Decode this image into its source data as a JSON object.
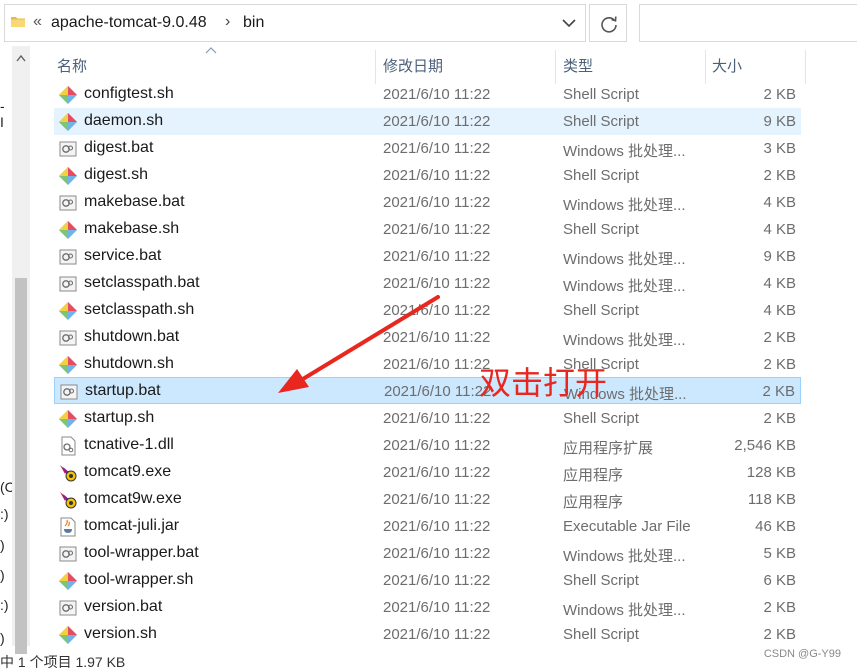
{
  "address": {
    "segments": [
      "apache-tomcat-9.0.48",
      "bin"
    ],
    "chevron": "«",
    "separator": "›"
  },
  "left_nav_fragments": [
    "- I",
    "(C",
    ":)",
    ")",
    ")",
    ":)",
    ")"
  ],
  "columns": {
    "name": "名称",
    "date": "修改日期",
    "type": "类型",
    "size": "大小"
  },
  "files": [
    {
      "name": "configtest.sh",
      "date": "2021/6/10 11:22",
      "type": "Shell Script",
      "size": "2 KB",
      "icon": "shell-script-icon"
    },
    {
      "name": "daemon.sh",
      "date": "2021/6/10 11:22",
      "type": "Shell Script",
      "size": "9 KB",
      "icon": "shell-script-icon",
      "state": "hover"
    },
    {
      "name": "digest.bat",
      "date": "2021/6/10 11:22",
      "type": "Windows 批处理...",
      "size": "3 KB",
      "icon": "batch-file-icon"
    },
    {
      "name": "digest.sh",
      "date": "2021/6/10 11:22",
      "type": "Shell Script",
      "size": "2 KB",
      "icon": "shell-script-icon"
    },
    {
      "name": "makebase.bat",
      "date": "2021/6/10 11:22",
      "type": "Windows 批处理...",
      "size": "4 KB",
      "icon": "batch-file-icon"
    },
    {
      "name": "makebase.sh",
      "date": "2021/6/10 11:22",
      "type": "Shell Script",
      "size": "4 KB",
      "icon": "shell-script-icon"
    },
    {
      "name": "service.bat",
      "date": "2021/6/10 11:22",
      "type": "Windows 批处理...",
      "size": "9 KB",
      "icon": "batch-file-icon"
    },
    {
      "name": "setclasspath.bat",
      "date": "2021/6/10 11:22",
      "type": "Windows 批处理...",
      "size": "4 KB",
      "icon": "batch-file-icon"
    },
    {
      "name": "setclasspath.sh",
      "date": "2021/6/10 11:22",
      "type": "Shell Script",
      "size": "4 KB",
      "icon": "shell-script-icon"
    },
    {
      "name": "shutdown.bat",
      "date": "2021/6/10 11:22",
      "type": "Windows 批处理...",
      "size": "2 KB",
      "icon": "batch-file-icon"
    },
    {
      "name": "shutdown.sh",
      "date": "2021/6/10 11:22",
      "type": "Shell Script",
      "size": "2 KB",
      "icon": "shell-script-icon"
    },
    {
      "name": "startup.bat",
      "date": "2021/6/10 11:22",
      "type": "Windows 批处理...",
      "size": "2 KB",
      "icon": "batch-file-icon",
      "state": "selected"
    },
    {
      "name": "startup.sh",
      "date": "2021/6/10 11:22",
      "type": "Shell Script",
      "size": "2 KB",
      "icon": "shell-script-icon"
    },
    {
      "name": "tcnative-1.dll",
      "date": "2021/6/10 11:22",
      "type": "应用程序扩展",
      "size": "2,546 KB",
      "icon": "dll-file-icon"
    },
    {
      "name": "tomcat9.exe",
      "date": "2021/6/10 11:22",
      "type": "应用程序",
      "size": "128 KB",
      "icon": "tomcat-exe-icon"
    },
    {
      "name": "tomcat9w.exe",
      "date": "2021/6/10 11:22",
      "type": "应用程序",
      "size": "118 KB",
      "icon": "tomcat-exe-icon"
    },
    {
      "name": "tomcat-juli.jar",
      "date": "2021/6/10 11:22",
      "type": "Executable Jar File",
      "size": "46 KB",
      "icon": "jar-file-icon"
    },
    {
      "name": "tool-wrapper.bat",
      "date": "2021/6/10 11:22",
      "type": "Windows 批处理...",
      "size": "5 KB",
      "icon": "batch-file-icon"
    },
    {
      "name": "tool-wrapper.sh",
      "date": "2021/6/10 11:22",
      "type": "Shell Script",
      "size": "6 KB",
      "icon": "shell-script-icon"
    },
    {
      "name": "version.bat",
      "date": "2021/6/10 11:22",
      "type": "Windows 批处理...",
      "size": "2 KB",
      "icon": "batch-file-icon"
    },
    {
      "name": "version.sh",
      "date": "2021/6/10 11:22",
      "type": "Shell Script",
      "size": "2 KB",
      "icon": "shell-script-icon"
    }
  ],
  "status_bar": "中 1 个项目  1.97 KB",
  "annotation": {
    "text": "双击打开",
    "color": "#e8271f"
  },
  "watermark": "CSDN @G-Y99",
  "colors": {
    "hover": "#e5f3ff",
    "selected": "#cce8ff",
    "selected_border": "#99d1ff",
    "header_text": "#4c607a"
  }
}
